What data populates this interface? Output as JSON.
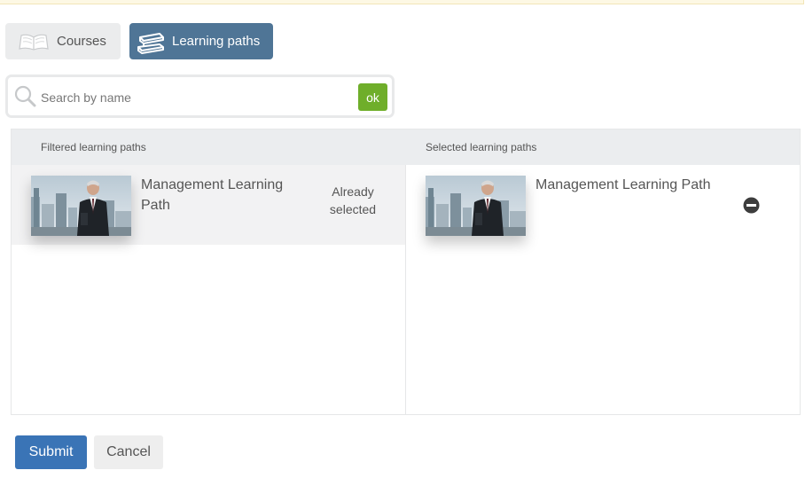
{
  "tabs": {
    "courses": {
      "label": "Courses",
      "icon": "open-book-icon"
    },
    "learning_paths": {
      "label": "Learning paths",
      "icon": "book-stack-icon",
      "active": true
    }
  },
  "search": {
    "placeholder": "Search by name",
    "value": "",
    "button_label": "ok"
  },
  "filtered": {
    "header": "Filtered learning paths",
    "items": [
      {
        "title": "Management Learning Path",
        "status": "Already selected"
      }
    ]
  },
  "selected": {
    "header": "Selected learning paths",
    "items": [
      {
        "title": "Management Learning Path",
        "action_icon": "remove-icon"
      }
    ]
  },
  "actions": {
    "submit_label": "Submit",
    "cancel_label": "Cancel"
  },
  "colors": {
    "active_tab": "#4f7596",
    "ok_button": "#6fae2a",
    "submit_button": "#3a74b6"
  }
}
